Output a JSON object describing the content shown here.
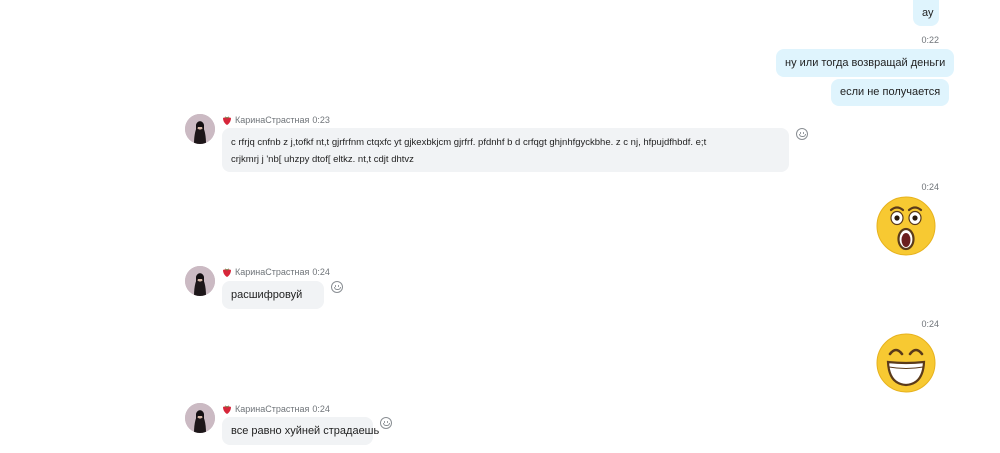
{
  "colors": {
    "outgoing_bubble": "#dff4fd",
    "incoming_bubble": "#f1f3f5",
    "meta_text": "#6f7479",
    "emoji_yellow": "#f7c932"
  },
  "messages": {
    "out_1": {
      "text": "ау"
    },
    "out_time_1": "0:22",
    "out_2": {
      "text": "ну или тогда возвращай деньги"
    },
    "out_3": {
      "text": "если не получается"
    },
    "in_1": {
      "sender": "КаринаСтрастная",
      "time": "0:23",
      "line1": "c rfrjq cnfnb  z j,tofkf nt,t gjrfrfnm ctqxfc yt gjkexbkjcm gjrfrf. pfdnhf b d crfqgt ghjnhfgyckbhe. z c nj, hfpujdfhbdf. e;t",
      "line2": "crjkmrj j 'nb[ uhzpy dtof[ eltkz. nt,t cdjt dhtvz",
      "reaction_icon": "smiley-outline-icon"
    },
    "out_emoji_1": {
      "time": "0:24",
      "icon": "surprised-face-emoji"
    },
    "in_2": {
      "sender": "КаринаСтрастная",
      "time": "0:24",
      "text": "расшифровуй",
      "reaction_icon": "smiley-outline-icon"
    },
    "out_emoji_2": {
      "time": "0:24",
      "icon": "laughing-face-emoji"
    },
    "in_3": {
      "sender": "КаринаСтрастная",
      "time": "0:24",
      "text": "все равно хуйней страдаешь",
      "reaction_icon": "smiley-outline-icon"
    }
  }
}
